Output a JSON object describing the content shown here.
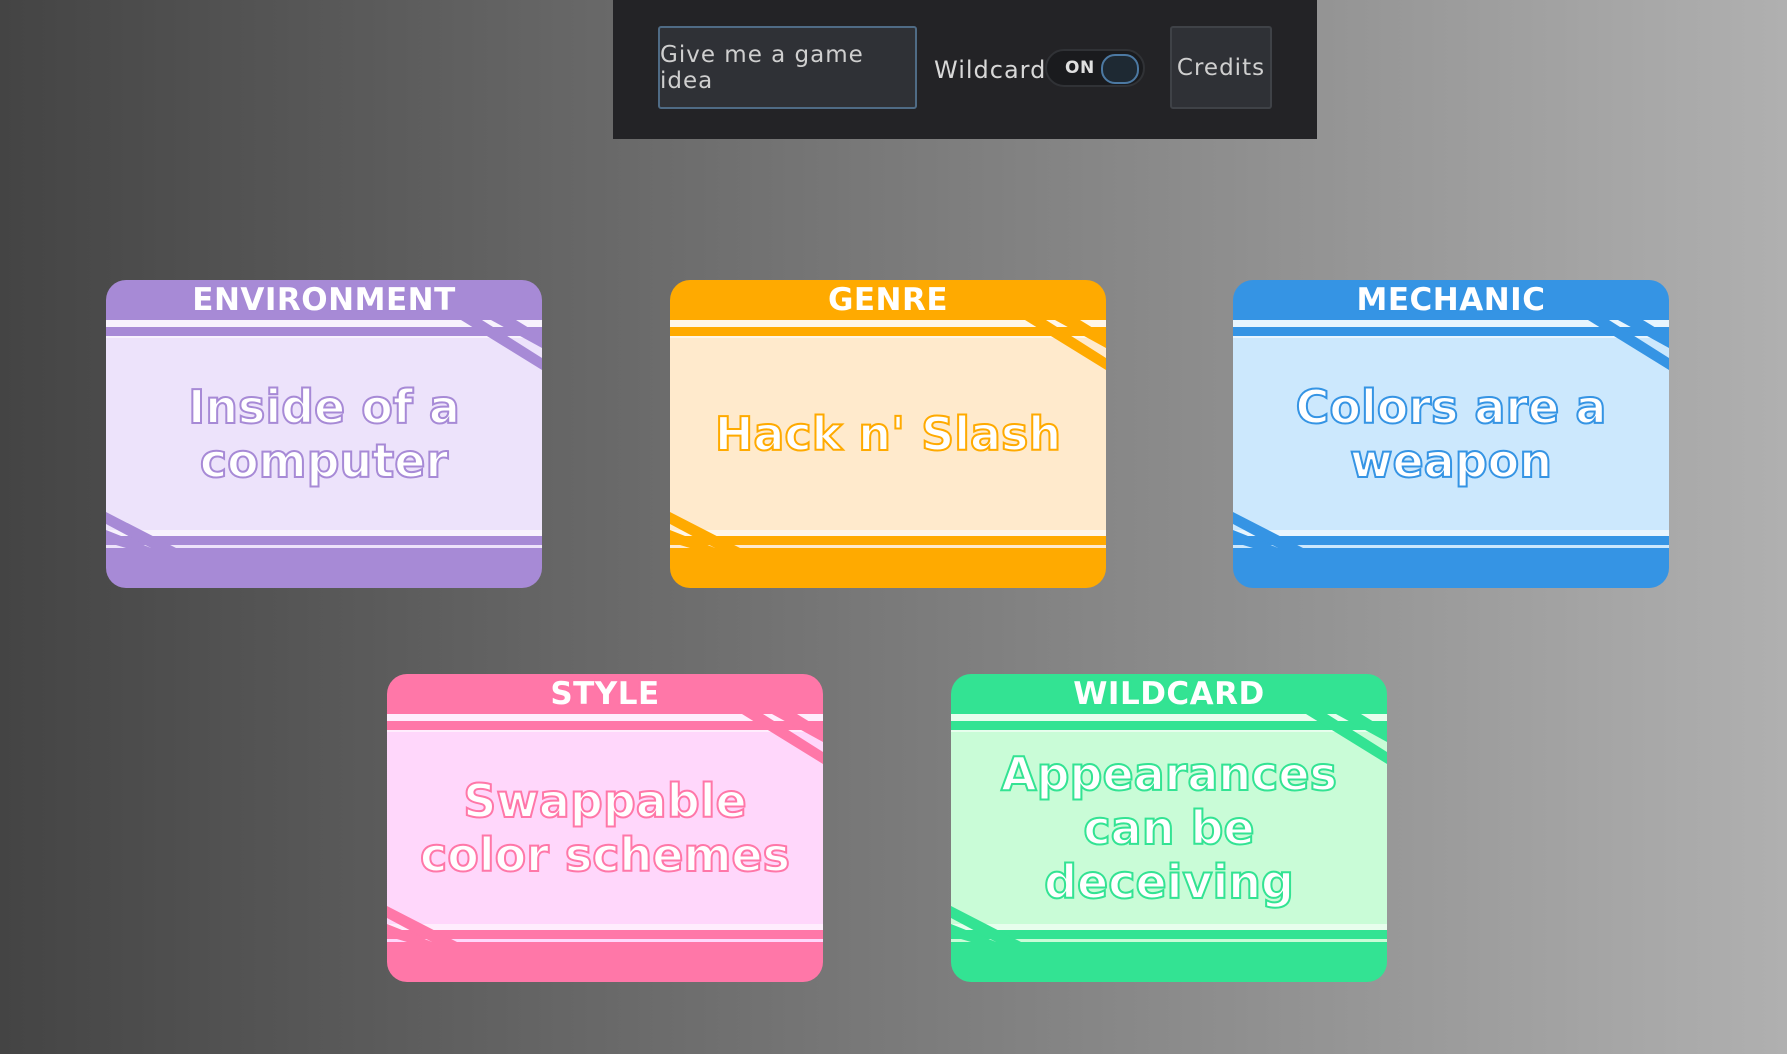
{
  "toolbar": {
    "idea_label": "Give me a game idea",
    "wildcard_label": "Wildcard",
    "toggle_state": "ON",
    "credits_label": "Credits"
  },
  "cards": [
    {
      "title": "ENVIRONMENT",
      "value": "Inside of a computer",
      "color": "#a78ad6",
      "fill": "#ede3fb",
      "stroke": "#ffffff"
    },
    {
      "title": "GENRE",
      "value": "Hack n' Slash",
      "color": "#ffaa00",
      "fill": "#ffeacc",
      "stroke": "#ffffff"
    },
    {
      "title": "MECHANIC",
      "value": "Colors are a weapon",
      "color": "#3594e4",
      "fill": "#cce8fd",
      "stroke": "#ffffff"
    },
    {
      "title": "STYLE",
      "value": "Swappable color schemes",
      "color": "#ff77a8",
      "fill": "#ffd7fb",
      "stroke": "#ffffff"
    },
    {
      "title": "WILDCARD",
      "value": "Appearances can be deceiving",
      "color": "#33e393",
      "fill": "#c9fcd7",
      "stroke": "#ffffff"
    }
  ]
}
